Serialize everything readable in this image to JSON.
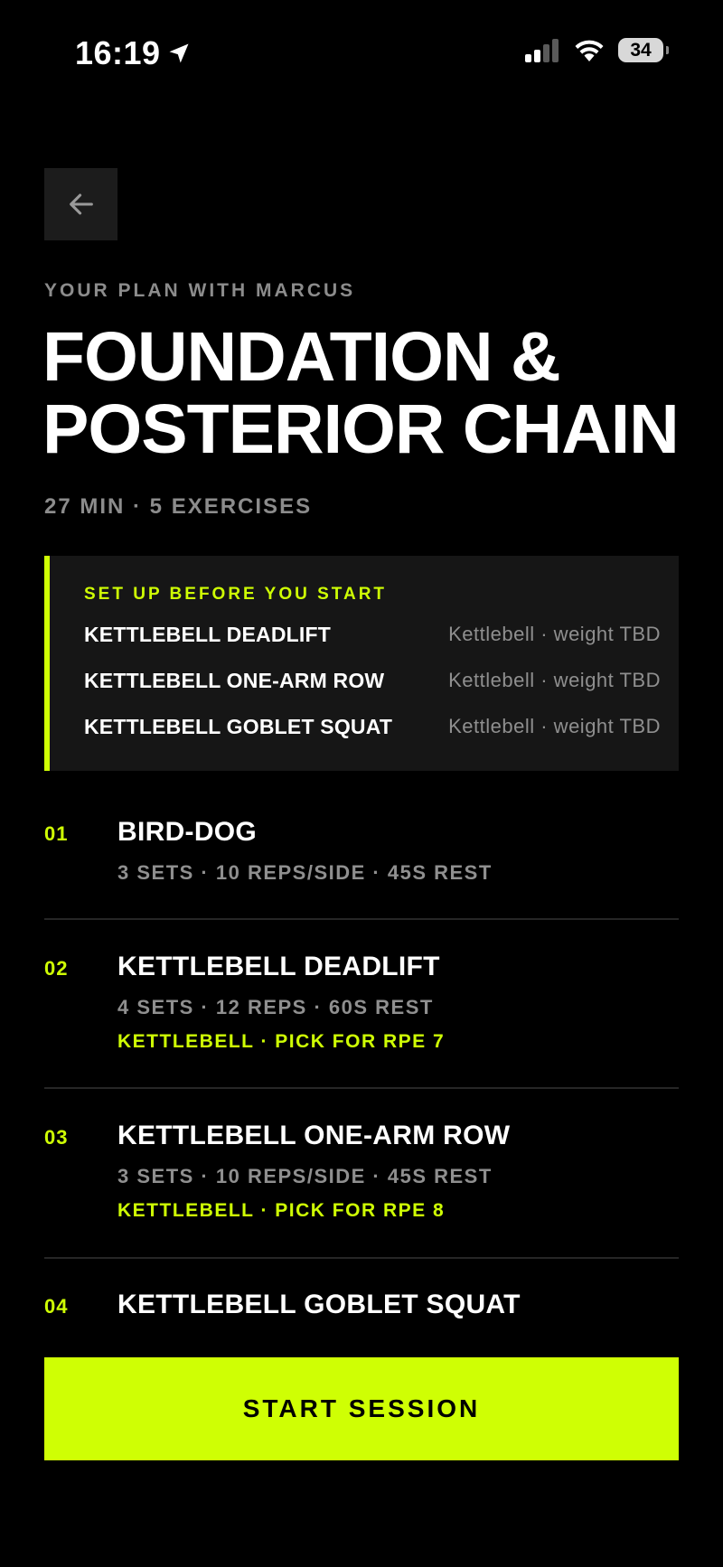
{
  "status_bar": {
    "time": "16:19",
    "battery": "34",
    "icons": [
      "location-arrow-icon",
      "cellular-signal-icon",
      "wifi-icon",
      "battery-icon"
    ]
  },
  "header": {
    "back_icon": "arrow-left-icon",
    "eyebrow": "YOUR PLAN WITH MARCUS",
    "title_line1": "FOUNDATION &",
    "title_line2": "POSTERIOR CHAIN",
    "meta": "27 MIN · 5 EXERCISES"
  },
  "setup": {
    "heading": "SET UP BEFORE YOU START",
    "items": [
      {
        "name": "KETTLEBELL DEADLIFT",
        "equipment": "Kettlebell · weight TBD"
      },
      {
        "name": "KETTLEBELL ONE-ARM ROW",
        "equipment": "Kettlebell · weight TBD"
      },
      {
        "name": "KETTLEBELL GOBLET SQUAT",
        "equipment": "Kettlebell · weight TBD"
      }
    ]
  },
  "exercises": [
    {
      "number": "01",
      "name": "BIRD-DOG",
      "detail": "3 SETS · 10 REPS/SIDE · 45S REST",
      "equipment": ""
    },
    {
      "number": "02",
      "name": "KETTLEBELL DEADLIFT",
      "detail": "4 SETS · 12 REPS · 60S REST",
      "equipment": "KETTLEBELL · PICK FOR RPE 7"
    },
    {
      "number": "03",
      "name": "KETTLEBELL ONE-ARM ROW",
      "detail": "3 SETS · 10 REPS/SIDE · 45S REST",
      "equipment": "KETTLEBELL · PICK FOR RPE 8"
    },
    {
      "number": "04",
      "name": "KETTLEBELL GOBLET SQUAT",
      "detail": "",
      "equipment": ""
    }
  ],
  "actions": {
    "start_label": "START SESSION"
  },
  "colors": {
    "accent": "#cfff04",
    "background": "#000000",
    "card": "#161616",
    "muted_text": "#8f8f8f"
  }
}
